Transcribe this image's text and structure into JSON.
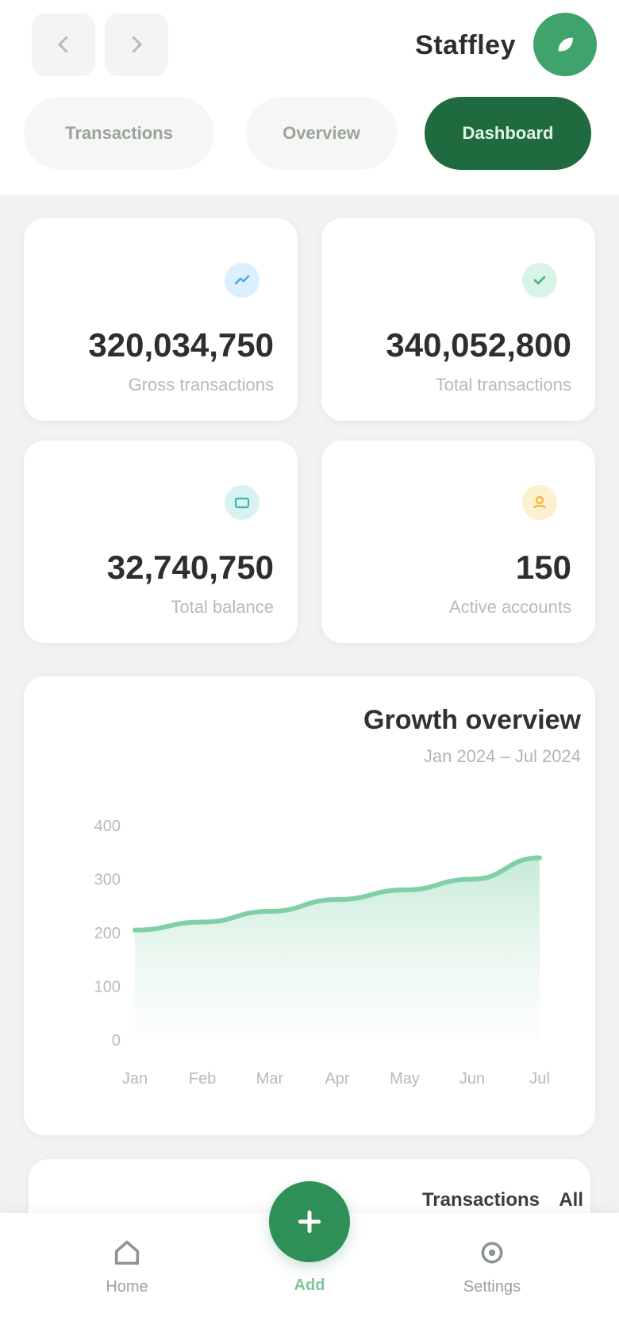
{
  "header": {
    "brand": "Staffley",
    "tabs": [
      {
        "label": "Transactions"
      },
      {
        "label": "Overview"
      },
      {
        "label": "Dashboard"
      }
    ]
  },
  "stats": [
    {
      "value": "320,034,750",
      "label": "Gross transactions",
      "icon": "trend-icon",
      "color": "#4aa8e6"
    },
    {
      "value": "340,052,800",
      "label": "Total transactions",
      "icon": "check-icon",
      "color": "#3fb07a"
    },
    {
      "value": "32,740,750",
      "label": "Total balance",
      "icon": "wallet-icon",
      "color": "#3bb6b0"
    },
    {
      "value": "150",
      "label": "Active accounts",
      "icon": "users-icon",
      "color": "#f2b735"
    }
  ],
  "chart": {
    "title": "Growth overview",
    "subtitle": "Jan 2024 – Jul 2024"
  },
  "chart_data": {
    "type": "area",
    "x": [
      "Jan",
      "Feb",
      "Mar",
      "Apr",
      "May",
      "Jun",
      "Jul"
    ],
    "values": [
      205,
      220,
      240,
      262,
      280,
      300,
      340
    ],
    "ylim": [
      0,
      400
    ],
    "yticks": [
      0,
      100,
      200,
      300,
      400
    ],
    "color": "#7fd0a6",
    "grid": false
  },
  "peek": {
    "text": "Transactions",
    "link": "All"
  },
  "nav": {
    "home": "Home",
    "add": "Add",
    "settings": "Settings"
  },
  "colors": {
    "accent": "#2e8f57",
    "accent_dark": "#1f6b3f"
  }
}
